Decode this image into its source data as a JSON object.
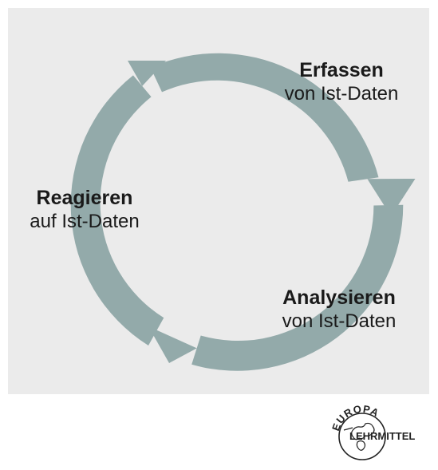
{
  "background_color": "#ebebeb",
  "arrow_color": "#93aaaa",
  "steps": [
    {
      "title": "Erfassen",
      "subtitle": "von Ist-Daten"
    },
    {
      "title": "Analysieren",
      "subtitle": "von Ist-Daten"
    },
    {
      "title": "Reagieren",
      "subtitle": "auf Ist-Daten"
    }
  ],
  "logo": {
    "top_text": "EUROPA",
    "bottom_text": "LEHRMITTEL",
    "icon": "globe-icon"
  }
}
